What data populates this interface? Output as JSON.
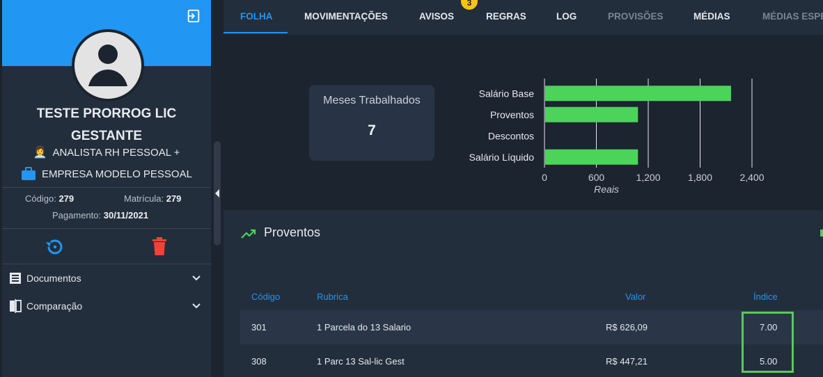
{
  "profile": {
    "name": "TESTE PRORROG LIC GESTANTE",
    "role": "ANALISTA RH PESSOAL +",
    "company": "EMPRESA MODELO PESSOAL",
    "codigo_label": "Código:",
    "codigo_value": "279",
    "matricula_label": "Matrícula:",
    "matricula_value": "279",
    "pagamento_label": "Pagamento:",
    "pagamento_value": "30/11/2021"
  },
  "sidebar_menu": [
    {
      "label": "Documentos",
      "icon": "document-list-icon"
    },
    {
      "label": "Comparação",
      "icon": "compare-icon"
    }
  ],
  "tabs": [
    {
      "label": "FOLHA",
      "state": "active"
    },
    {
      "label": "MOVIMENTAÇÕES",
      "state": "normal"
    },
    {
      "label": "AVISOS",
      "state": "normal",
      "badge": "3"
    },
    {
      "label": "REGRAS",
      "state": "normal"
    },
    {
      "label": "LOG",
      "state": "normal"
    },
    {
      "label": "PROVISÕES",
      "state": "disabled"
    },
    {
      "label": "MÉDIAS",
      "state": "normal"
    },
    {
      "label": "MÉDIAS ESPE",
      "state": "disabled"
    }
  ],
  "stat": {
    "label": "Meses Trabalhados",
    "value": "7"
  },
  "chart_data": {
    "type": "bar",
    "orientation": "horizontal",
    "categories": [
      "Salário Base",
      "Proventos",
      "Descontos",
      "Salário Líquido"
    ],
    "values": [
      2150,
      1073.3,
      0,
      1073.3
    ],
    "xlabel": "Reais",
    "ylabel": "",
    "xlim": [
      0,
      2400
    ],
    "ticks": [
      "0",
      "600",
      "1,200",
      "1,800",
      "2,400"
    ],
    "grid": true,
    "color": "#4cd35a"
  },
  "proventos": {
    "title": "Proventos",
    "columns": {
      "codigo": "Código",
      "rubrica": "Rubrica",
      "valor": "Valor",
      "indice": "Índice"
    },
    "rows": [
      {
        "codigo": "301",
        "rubrica": "1 Parcela do 13 Salario",
        "valor": "R$ 626,09",
        "indice": "7.00"
      },
      {
        "codigo": "308",
        "rubrica": "1 Parc 13 Sal-lic Gest",
        "valor": "R$ 447,21",
        "indice": "5.00"
      }
    ]
  },
  "colors": {
    "accent": "#2196f3",
    "success": "#4cd35a",
    "danger": "#f44336",
    "badge": "#f5c518"
  }
}
